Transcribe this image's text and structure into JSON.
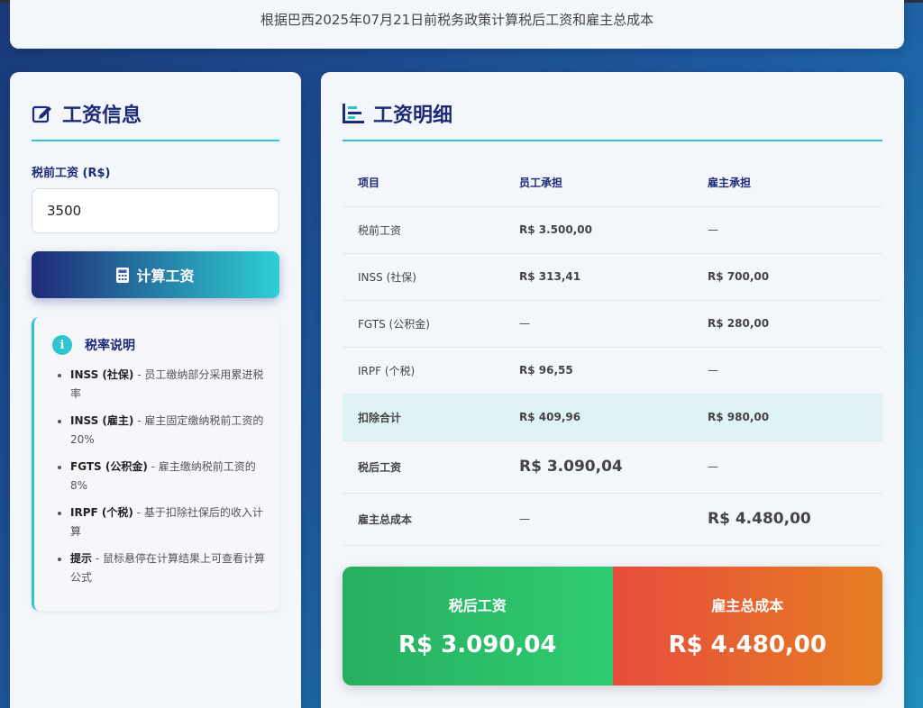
{
  "header": {
    "subtitle": "根据巴西2025年07月21日前税务政策计算税后工资和雇主总成本"
  },
  "salary_panel": {
    "title": "工资信息",
    "field_label": "税前工资 (R$)",
    "input_value": "3500",
    "button_label": "计算工资"
  },
  "tax_info": {
    "title": "税率说明",
    "icon_text": "i",
    "items": [
      {
        "term": "INSS (社保)",
        "desc": " - 员工缴纳部分采用累进税率"
      },
      {
        "term": "INSS (雇主)",
        "desc": " - 雇主固定缴纳税前工资的20%"
      },
      {
        "term": "FGTS (公积金)",
        "desc": " - 雇主缴纳税前工资的8%"
      },
      {
        "term": "IRPF (个税)",
        "desc": " - 基于扣除社保后的收入计算"
      },
      {
        "term": "提示",
        "desc": " - 鼠标悬停在计算结果上可查看计算公式"
      }
    ]
  },
  "detail": {
    "title": "工资明细",
    "headers": [
      "项目",
      "员工承担",
      "雇主承担"
    ],
    "rows": [
      {
        "item": "税前工资",
        "employee": "R$ 3.500,00",
        "employer": "—"
      },
      {
        "item": "INSS (社保)",
        "employee": "R$ 313,41",
        "employer": "R$ 700,00"
      },
      {
        "item": "FGTS (公积金)",
        "employee": "—",
        "employer": "R$ 280,00"
      },
      {
        "item": "IRPF (个税)",
        "employee": "R$ 96,55",
        "employer": "—"
      },
      {
        "item": "扣除合计",
        "employee": "R$ 409,96",
        "employer": "R$ 980,00"
      },
      {
        "item": "税后工资",
        "employee": "R$ 3.090,04",
        "employer": "—"
      },
      {
        "item": "雇主总成本",
        "employee": "—",
        "employer": "R$ 4.480,00"
      }
    ]
  },
  "summary": {
    "net_label": "税后工资",
    "net_value": "R$ 3.090,04",
    "cost_label": "雇主总成本",
    "cost_value": "R$ 4.480,00"
  },
  "colors": {
    "navy": "#1e2a78",
    "teal": "#2ec4d0",
    "green": "#27ae60",
    "red": "#e74c3c",
    "orange": "#e67e22"
  }
}
